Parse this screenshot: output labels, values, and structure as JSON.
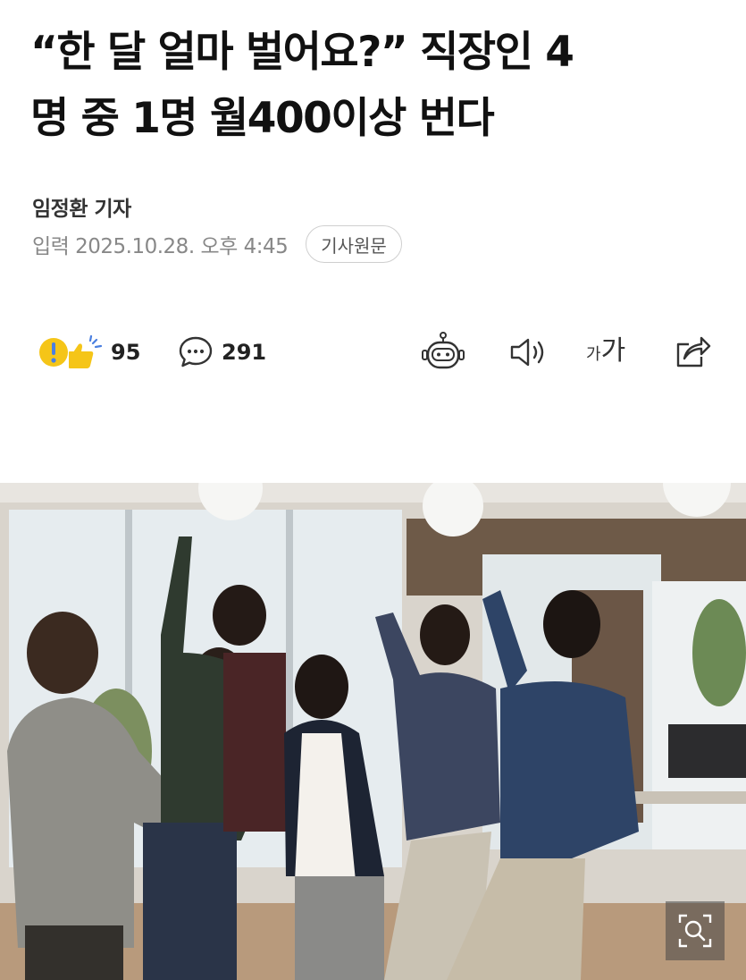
{
  "article": {
    "headline_line1": "“한 달 얼마 벌어요?” 직장인 4",
    "headline_line2": "명 중 1명 월400이상 번다",
    "reporter": "임정환 기자",
    "published": "입력 2025.10.28. 오후 4:45",
    "original_link_label": "기사원문"
  },
  "toolbar": {
    "reaction_count": "95",
    "comment_count": "291",
    "font_small_glyph": "가",
    "font_big_glyph": "가"
  },
  "icons": {
    "reaction": "reaction-emoji-icon",
    "comment": "comment-bubble-icon",
    "summary_bot": "robot-icon",
    "listen": "speaker-icon",
    "font_size": "font-size-icon",
    "share": "share-icon",
    "zoom": "zoom-search-icon"
  },
  "colors": {
    "reaction_yellow": "#f5c518",
    "reaction_blue": "#4a7fe0",
    "text_primary": "#111111",
    "text_muted": "#888888"
  }
}
